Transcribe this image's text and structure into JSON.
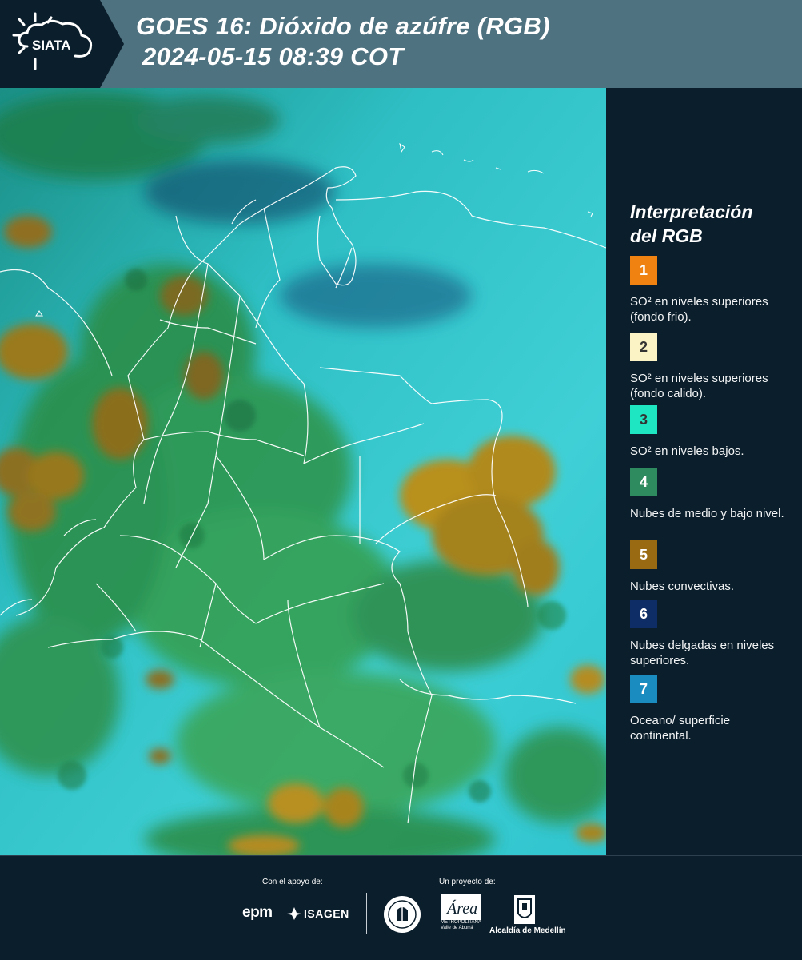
{
  "header": {
    "logo_text": "SIATA",
    "title_line1": "GOES 16: Dióxido de azúfre (RGB)",
    "title_line2": "2024-05-15 08:39 COT"
  },
  "legend": {
    "title_line1": "Interpretación",
    "title_line2": "del RGB",
    "items": [
      {
        "number": "1",
        "color": "#f08212",
        "num_color": "#ffffff",
        "text": "SO² en niveles superiores (fondo frio)."
      },
      {
        "number": "2",
        "color": "#fbf3c6",
        "num_color": "#333333",
        "text": "SO² en niveles superiores (fondo calido)."
      },
      {
        "number": "3",
        "color": "#1ee6c2",
        "num_color": "#333333",
        "text": "SO² en niveles bajos."
      },
      {
        "number": "4",
        "color": "#2e8b5f",
        "num_color": "#ffffff",
        "text": "Nubes de medio y bajo nivel."
      },
      {
        "number": "5",
        "color": "#9a6a12",
        "num_color": "#ffffff",
        "text": "Nubes convectivas."
      },
      {
        "number": "6",
        "color": "#0e2d66",
        "num_color": "#ffffff",
        "text": "Nubes delgadas en niveles superiores."
      },
      {
        "number": "7",
        "color": "#1a8cc0",
        "num_color": "#ffffff",
        "text": "Oceano/ superficie continental."
      }
    ]
  },
  "footer": {
    "support_label": "Con el apoyo de:",
    "project_label": "Un proyecto de:",
    "epm_text": "epm",
    "isagen_text": "ISAGEN",
    "area_text": "Área",
    "metro_text": "METROPOLITANA Valle de Aburrá",
    "alcaldia_text": "Alcaldía de Medellín"
  },
  "colors": {
    "background": "#0b1e2b",
    "header_band": "#4f7280",
    "sky_cyan": "#2ec3cc",
    "cloud_green": "#2f8f4c",
    "convective_brown": "#9a6a12"
  }
}
